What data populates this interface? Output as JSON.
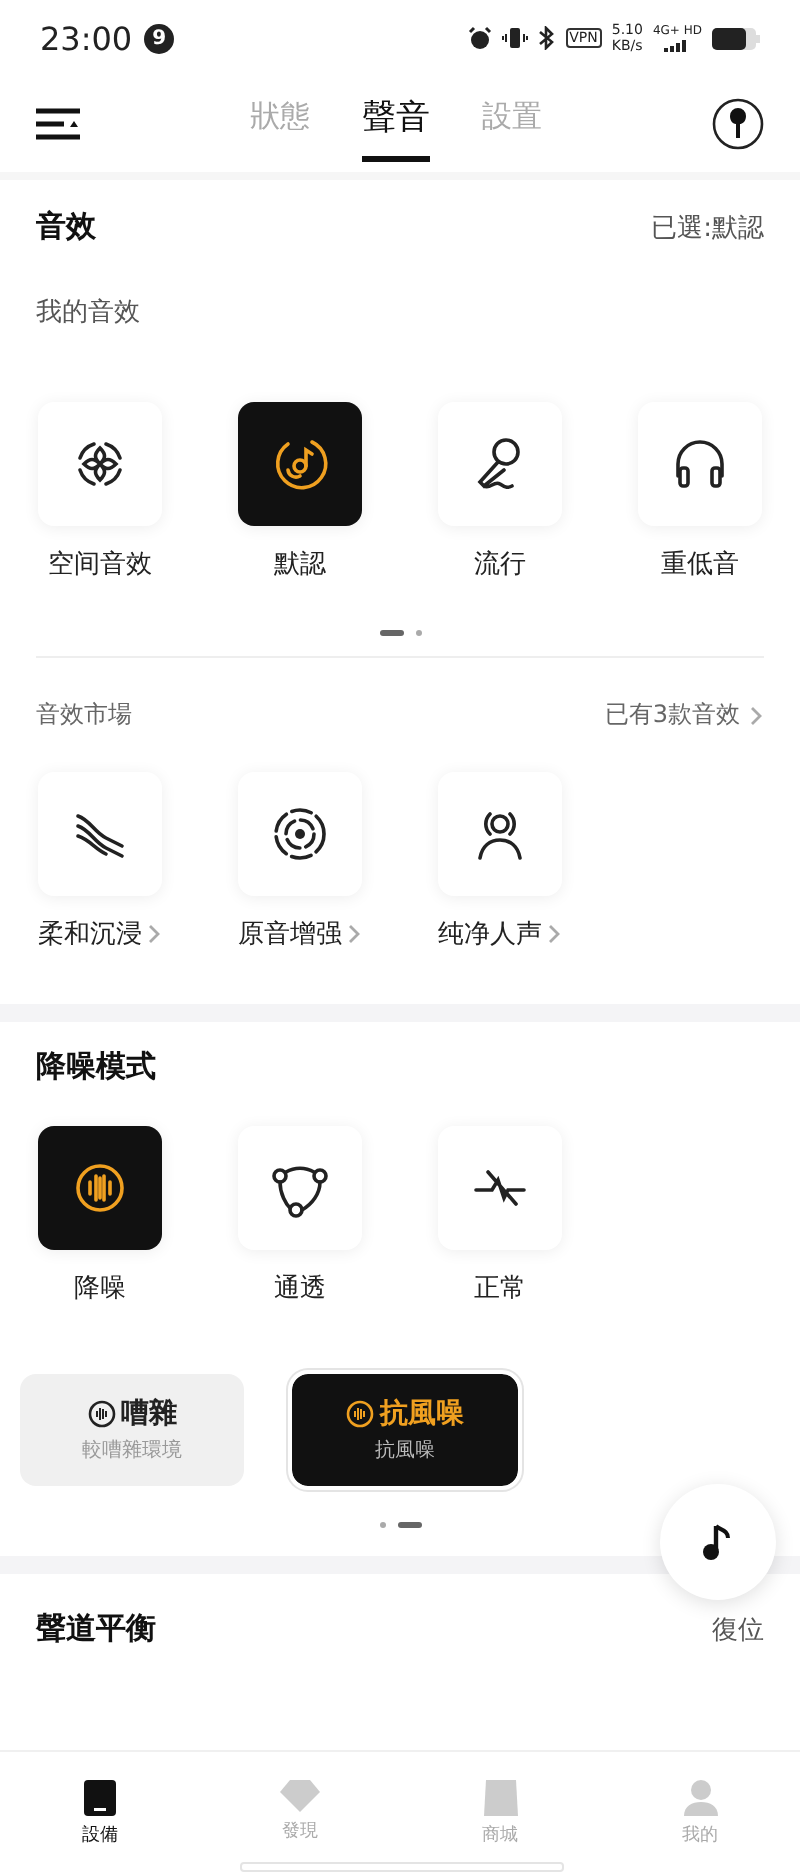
{
  "status_bar": {
    "time": "23:00",
    "badge": "9",
    "vpn": "VPN",
    "speed": "5.10",
    "speed_unit": "KB/s",
    "network": "4G+ HD"
  },
  "tabs": [
    {
      "label": "狀態",
      "selected": false
    },
    {
      "label": "聲音",
      "selected": true
    },
    {
      "label": "設置",
      "selected": false
    }
  ],
  "sound_effects": {
    "title": "音效",
    "current": "已選:默認",
    "subtitle": "我的音效",
    "items": [
      {
        "kind": "spatial",
        "label": "空间音效",
        "selected": false
      },
      {
        "kind": "disc",
        "label": "默認",
        "selected": true
      },
      {
        "kind": "mic",
        "label": "流行",
        "selected": false
      },
      {
        "kind": "headphones",
        "label": "重低音",
        "selected": false
      }
    ],
    "pages": [
      {
        "selected": true
      },
      {
        "selected": false
      }
    ],
    "market": {
      "title": "音效市場",
      "link": "已有3款音效",
      "items": [
        {
          "kind": "waves",
          "label": "柔和沉浸",
          "selected": false
        },
        {
          "kind": "target",
          "label": "原音增强",
          "selected": false
        },
        {
          "kind": "person",
          "label": "纯净人声",
          "selected": false
        }
      ]
    }
  },
  "noise_mode": {
    "title": "降噪模式",
    "items": [
      {
        "kind": "anc",
        "label": "降噪",
        "selected": true
      },
      {
        "kind": "nodes",
        "label": "通透",
        "selected": false
      },
      {
        "kind": "off",
        "label": "正常",
        "selected": false
      }
    ],
    "scenes": [
      {
        "title": "嘈雜",
        "subtitle": "較嘈雜環境",
        "selected": false
      },
      {
        "title": "抗風噪",
        "subtitle": "抗風噪",
        "selected": true
      }
    ],
    "pages": [
      {
        "selected": false
      },
      {
        "selected": true
      }
    ]
  },
  "balance": {
    "title": "聲道平衡",
    "action": "復位"
  },
  "bottom_nav": [
    {
      "kind": "device",
      "label": "設備",
      "selected": true
    },
    {
      "kind": "discover",
      "label": "發現",
      "selected": false
    },
    {
      "kind": "shop",
      "label": "商城",
      "selected": false
    },
    {
      "kind": "me",
      "label": "我的",
      "selected": false
    }
  ]
}
